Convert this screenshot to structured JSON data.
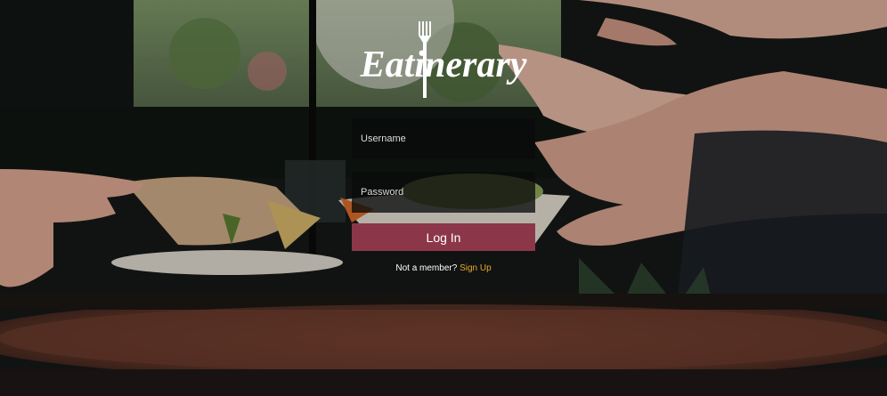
{
  "app": {
    "logo_text": "Eatinerary"
  },
  "login": {
    "username_placeholder": "Username",
    "password_placeholder": "Password",
    "login_label": "Log In",
    "member_prompt": "Not a member?",
    "signup_label": "Sign Up"
  },
  "colors": {
    "login_button": "#8c3749",
    "signup_link": "#e8a92b",
    "field_bg": "rgba(10,12,12,0.78)"
  },
  "icons": {
    "logo_fork": "fork-icon"
  }
}
